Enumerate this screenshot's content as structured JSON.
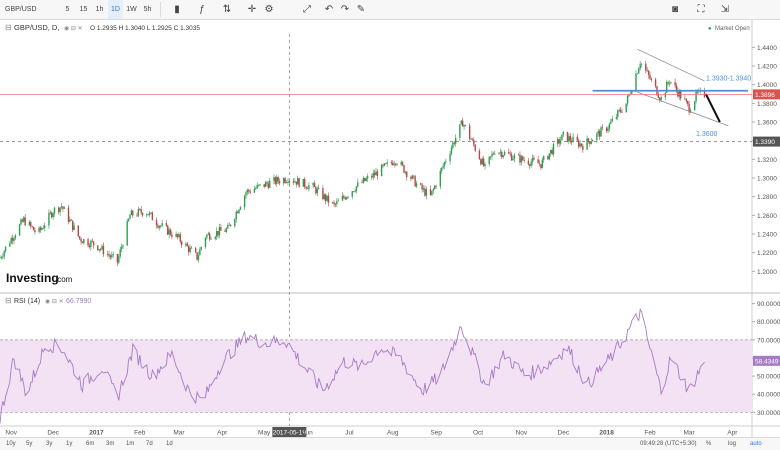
{
  "toolbar": {
    "symbol": "GBP/USD",
    "intervals": [
      "5",
      "15",
      "1h",
      "1D",
      "1W",
      "5h"
    ],
    "selected_interval": "1D",
    "icons": [
      "candles-icon",
      "indicators-icon",
      "compare-icon",
      "crosshair-icon",
      "settings-icon",
      "fit-icon",
      "undo-icon",
      "redo-icon",
      "drawing-icon",
      "camera-icon",
      "fullscreen-icon",
      "expand-icon"
    ]
  },
  "header": {
    "title": "GBP/USD, D,",
    "ohlc": "O 1.2935 H 1.3040 L 1.2925 C 1.3035",
    "market_status": "Market Open"
  },
  "logo": {
    "brand": "Investing",
    "suffix": ".com"
  },
  "colors": {
    "up": "#2e9e52",
    "down": "#b04a47",
    "rsi": "#a67bc6",
    "rsi_band": "#f3e2f3",
    "resistance": "#4a90d9",
    "price_line": "#e8737b",
    "price_label": "#d9534f",
    "accent": "#2a7ad5"
  },
  "chart_data": [
    {
      "type": "candlestick",
      "series_name": "GBP/USD, D,",
      "x_range": [
        "2016-10-24",
        "2018-04-15"
      ],
      "ylim": [
        1.18,
        1.45
      ],
      "y_ticks": [
        "1.4400",
        "1.4200",
        "1.4000",
        "1.3800",
        "1.3600",
        "1.3400",
        "1.3200",
        "1.3000",
        "1.2800",
        "1.2600",
        "1.2400",
        "1.2200",
        "1.2000"
      ],
      "x_ticks": [
        "Nov",
        "Dec",
        "2017",
        "Feb",
        "Mar",
        "Apr",
        "May",
        "Jun",
        "Jul",
        "Aug",
        "Sep",
        "Oct",
        "Nov",
        "Dec",
        "2018",
        "Feb",
        "Mar",
        "Apr"
      ],
      "close_path": [
        [
          "2016-10-24",
          1.215
        ],
        [
          "2016-11-01",
          1.235
        ],
        [
          "2016-11-10",
          1.255
        ],
        [
          "2016-11-20",
          1.24
        ],
        [
          "2016-12-01",
          1.265
        ],
        [
          "2016-12-07",
          1.27
        ],
        [
          "2016-12-20",
          1.235
        ],
        [
          "2017-01-01",
          1.228
        ],
        [
          "2017-01-16",
          1.21
        ],
        [
          "2017-01-25",
          1.26
        ],
        [
          "2017-02-05",
          1.265
        ],
        [
          "2017-02-15",
          1.25
        ],
        [
          "2017-03-01",
          1.235
        ],
        [
          "2017-03-14",
          1.215
        ],
        [
          "2017-03-20",
          1.238
        ],
        [
          "2017-04-05",
          1.245
        ],
        [
          "2017-04-18",
          1.285
        ],
        [
          "2017-05-05",
          1.295
        ],
        [
          "2017-05-18",
          1.3
        ],
        [
          "2017-06-05",
          1.29
        ],
        [
          "2017-06-20",
          1.27
        ],
        [
          "2017-07-05",
          1.29
        ],
        [
          "2017-07-20",
          1.305
        ],
        [
          "2017-08-03",
          1.32
        ],
        [
          "2017-08-20",
          1.29
        ],
        [
          "2017-08-28",
          1.28
        ],
        [
          "2017-09-08",
          1.32
        ],
        [
          "2017-09-20",
          1.36
        ],
        [
          "2017-10-06",
          1.31
        ],
        [
          "2017-10-13",
          1.33
        ],
        [
          "2017-11-01",
          1.32
        ],
        [
          "2017-11-15",
          1.315
        ],
        [
          "2017-12-01",
          1.345
        ],
        [
          "2017-12-15",
          1.335
        ],
        [
          "2018-01-02",
          1.355
        ],
        [
          "2018-01-15",
          1.38
        ],
        [
          "2018-01-25",
          1.425
        ],
        [
          "2018-02-09",
          1.385
        ],
        [
          "2018-02-15",
          1.405
        ],
        [
          "2018-03-01",
          1.375
        ],
        [
          "2018-03-07",
          1.39
        ],
        [
          "2018-03-12",
          1.3896
        ]
      ],
      "last_price_label": "1.3896",
      "level_label": "1.3390",
      "annotations": [
        {
          "text": "1.3930-1.3940",
          "y": 1.3935
        },
        {
          "text": "1.3600",
          "y": 1.36
        }
      ],
      "resistance_y": 1.3935,
      "price_line_y": 1.3896,
      "level_y": 1.339,
      "channel": {
        "upper": [
          [
            "2018-01-23",
            1.438
          ],
          [
            "2018-03-12",
            1.404
          ]
        ],
        "lower": [
          [
            "2018-01-23",
            1.392
          ],
          [
            "2018-03-29",
            1.356
          ]
        ]
      },
      "projection": [
        [
          "2018-03-13",
          1.39
        ],
        [
          "2018-03-23",
          1.36
        ]
      ]
    },
    {
      "type": "line",
      "series_name": "RSI (14)",
      "value_label": "66.7990",
      "last_value_label": "58.4349",
      "ylim": [
        23,
        92
      ],
      "y_ticks": [
        "90.0000",
        "80.0000",
        "70.0000",
        "60.0000",
        "50.0000",
        "40.0000",
        "30.0000"
      ],
      "band": [
        30,
        70
      ],
      "points": [
        [
          "2016-10-24",
          27
        ],
        [
          "2016-11-03",
          60
        ],
        [
          "2016-11-12",
          40
        ],
        [
          "2016-11-26",
          68
        ],
        [
          "2016-12-08",
          65
        ],
        [
          "2016-12-22",
          45
        ],
        [
          "2017-01-05",
          55
        ],
        [
          "2017-01-16",
          38
        ],
        [
          "2017-01-27",
          64
        ],
        [
          "2017-02-10",
          50
        ],
        [
          "2017-02-24",
          62
        ],
        [
          "2017-03-08",
          42
        ],
        [
          "2017-03-18",
          36
        ],
        [
          "2017-04-01",
          58
        ],
        [
          "2017-04-18",
          72
        ],
        [
          "2017-05-03",
          68
        ],
        [
          "2017-05-16",
          70
        ],
        [
          "2017-05-29",
          56
        ],
        [
          "2017-06-12",
          42
        ],
        [
          "2017-06-27",
          58
        ],
        [
          "2017-07-10",
          55
        ],
        [
          "2017-07-23",
          66
        ],
        [
          "2017-08-06",
          60
        ],
        [
          "2017-08-22",
          42
        ],
        [
          "2017-09-04",
          50
        ],
        [
          "2017-09-19",
          78
        ],
        [
          "2017-10-06",
          45
        ],
        [
          "2017-10-20",
          62
        ],
        [
          "2017-11-04",
          50
        ],
        [
          "2017-11-19",
          56
        ],
        [
          "2017-12-04",
          66
        ],
        [
          "2017-12-18",
          45
        ],
        [
          "2018-01-06",
          62
        ],
        [
          "2018-01-25",
          85
        ],
        [
          "2018-02-09",
          42
        ],
        [
          "2018-02-16",
          60
        ],
        [
          "2018-03-01",
          42
        ],
        [
          "2018-03-12",
          58.4
        ]
      ],
      "x_ticks": [
        "Nov",
        "Dec",
        "2017",
        "Feb",
        "Mar",
        "Apr",
        "May",
        "2017-05-19",
        "Jun",
        "Jul",
        "Aug",
        "Sep",
        "Oct",
        "Nov",
        "Dec",
        "2018",
        "Feb",
        "Mar",
        "Apr"
      ],
      "crosshair_x": "2017-05-19"
    }
  ],
  "footer": {
    "ranges": [
      "10y",
      "5y",
      "3y",
      "1y",
      "6m",
      "3m",
      "1m",
      "7d",
      "1d"
    ],
    "time": "09:49:28 (UTC+5:30)",
    "options": [
      "%",
      "log",
      "auto"
    ],
    "active_option": "auto"
  }
}
